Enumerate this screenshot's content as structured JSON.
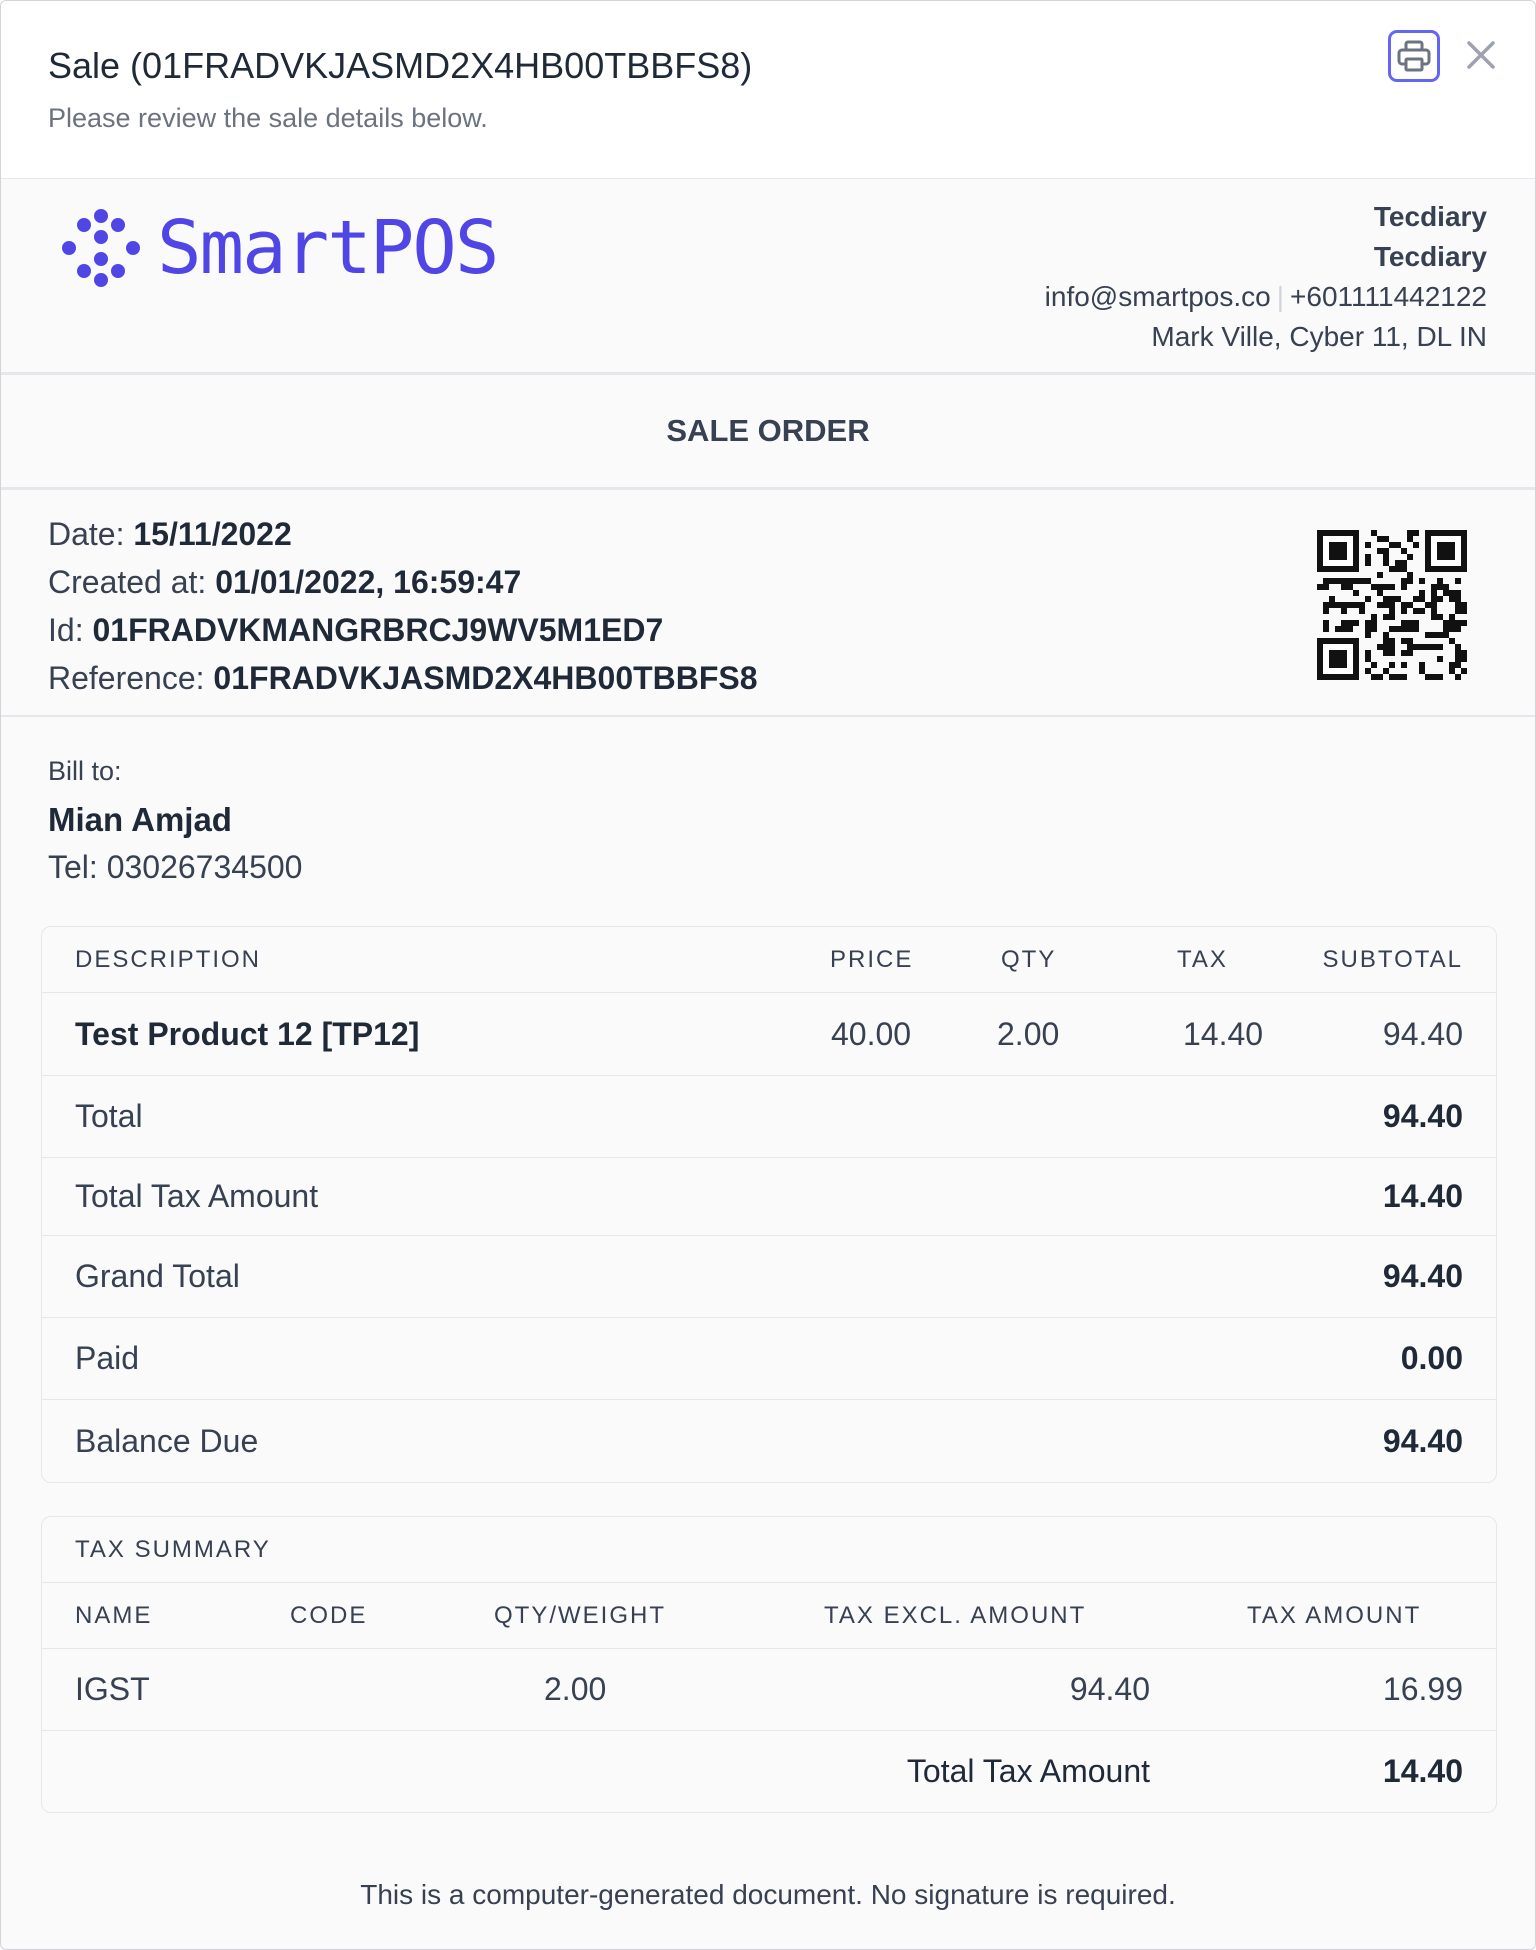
{
  "modal": {
    "title": "Sale (01FRADVKJASMD2X4HB00TBBFS8)",
    "subtitle": "Please review the sale details below.",
    "print_icon": "printer-icon",
    "close_icon": "close-icon"
  },
  "company": {
    "logo_text": "SmartPOS",
    "name_line1": "Tecdiary",
    "name_line2": "Tecdiary",
    "email": "info@smartpos.co",
    "phone": "+601111442122",
    "address": "Mark Ville, Cyber 11, DL IN"
  },
  "order_type": "SALE ORDER",
  "meta": {
    "date_label": "Date:",
    "date": "15/11/2022",
    "created_label": "Created at:",
    "created": "01/01/2022, 16:59:47",
    "id_label": "Id:",
    "id": "01FRADVKMANGRBRCJ9WV5M1ED7",
    "reference_label": "Reference:",
    "reference": "01FRADVKJASMD2X4HB00TBBFS8"
  },
  "bill": {
    "label": "Bill to:",
    "name": "Mian Amjad",
    "tel": "Tel: 03026734500"
  },
  "items_table": {
    "headers": [
      "DESCRIPTION",
      "PRICE",
      "QTY",
      "TAX",
      "SUBTOTAL"
    ],
    "rows": [
      {
        "description": "Test Product 12 [TP12]",
        "price": "40.00",
        "qty": "2.00",
        "tax": "14.40",
        "subtotal": "94.40"
      }
    ],
    "totals": [
      {
        "label": "Total",
        "value": "94.40"
      },
      {
        "label": "Total Tax Amount",
        "value": "14.40"
      },
      {
        "label": "Grand Total",
        "value": "94.40"
      },
      {
        "label": "Paid",
        "value": "0.00"
      },
      {
        "label": "Balance Due",
        "value": "94.40"
      }
    ]
  },
  "tax_summary": {
    "title": "TAX SUMMARY",
    "headers": [
      "NAME",
      "CODE",
      "QTY/WEIGHT",
      "TAX EXCL. AMOUNT",
      "TAX AMOUNT"
    ],
    "rows": [
      {
        "name": "IGST",
        "code": "",
        "qty": "2.00",
        "excl": "94.40",
        "amount": "16.99"
      }
    ],
    "total_label": "Total Tax Amount",
    "total_value": "14.40"
  },
  "footer": "This is a computer-generated document. No signature is required.",
  "colors": {
    "accent": "#4f46e5",
    "border": "#e5e7eb"
  }
}
